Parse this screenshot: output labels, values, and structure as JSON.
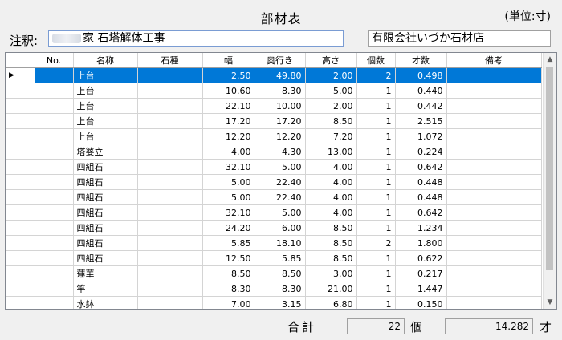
{
  "header": {
    "title": "部材表",
    "unit": "(単位:寸)"
  },
  "note": {
    "label": "注釈:",
    "value": "家 石塔解体工事"
  },
  "shop": {
    "value": "有限会社いづか石材店"
  },
  "columns": [
    "No.",
    "名称",
    "石種",
    "幅",
    "奥行き",
    "高さ",
    "個数",
    "才数",
    "備考"
  ],
  "rows": [
    {
      "no": "",
      "name": "上台",
      "stone": "",
      "width": "2.50",
      "depth": "49.80",
      "height": "2.00",
      "count": "2",
      "sai": "0.498",
      "note": ""
    },
    {
      "no": "",
      "name": "上台",
      "stone": "",
      "width": "10.60",
      "depth": "8.30",
      "height": "5.00",
      "count": "1",
      "sai": "0.440",
      "note": ""
    },
    {
      "no": "",
      "name": "上台",
      "stone": "",
      "width": "22.10",
      "depth": "10.00",
      "height": "2.00",
      "count": "1",
      "sai": "0.442",
      "note": ""
    },
    {
      "no": "",
      "name": "上台",
      "stone": "",
      "width": "17.20",
      "depth": "17.20",
      "height": "8.50",
      "count": "1",
      "sai": "2.515",
      "note": ""
    },
    {
      "no": "",
      "name": "上台",
      "stone": "",
      "width": "12.20",
      "depth": "12.20",
      "height": "7.20",
      "count": "1",
      "sai": "1.072",
      "note": ""
    },
    {
      "no": "",
      "name": "塔婆立",
      "stone": "",
      "width": "4.00",
      "depth": "4.30",
      "height": "13.00",
      "count": "1",
      "sai": "0.224",
      "note": ""
    },
    {
      "no": "",
      "name": "四組石",
      "stone": "",
      "width": "32.10",
      "depth": "5.00",
      "height": "4.00",
      "count": "1",
      "sai": "0.642",
      "note": ""
    },
    {
      "no": "",
      "name": "四組石",
      "stone": "",
      "width": "5.00",
      "depth": "22.40",
      "height": "4.00",
      "count": "1",
      "sai": "0.448",
      "note": ""
    },
    {
      "no": "",
      "name": "四組石",
      "stone": "",
      "width": "5.00",
      "depth": "22.40",
      "height": "4.00",
      "count": "1",
      "sai": "0.448",
      "note": ""
    },
    {
      "no": "",
      "name": "四組石",
      "stone": "",
      "width": "32.10",
      "depth": "5.00",
      "height": "4.00",
      "count": "1",
      "sai": "0.642",
      "note": ""
    },
    {
      "no": "",
      "name": "四組石",
      "stone": "",
      "width": "24.20",
      "depth": "6.00",
      "height": "8.50",
      "count": "1",
      "sai": "1.234",
      "note": ""
    },
    {
      "no": "",
      "name": "四組石",
      "stone": "",
      "width": "5.85",
      "depth": "18.10",
      "height": "8.50",
      "count": "2",
      "sai": "1.800",
      "note": ""
    },
    {
      "no": "",
      "name": "四組石",
      "stone": "",
      "width": "12.50",
      "depth": "5.85",
      "height": "8.50",
      "count": "1",
      "sai": "0.622",
      "note": ""
    },
    {
      "no": "",
      "name": "蓮華",
      "stone": "",
      "width": "8.50",
      "depth": "8.50",
      "height": "3.00",
      "count": "1",
      "sai": "0.217",
      "note": ""
    },
    {
      "no": "",
      "name": "竿",
      "stone": "",
      "width": "8.30",
      "depth": "8.30",
      "height": "21.00",
      "count": "1",
      "sai": "1.447",
      "note": ""
    },
    {
      "no": "",
      "name": "水鉢",
      "stone": "",
      "width": "7.00",
      "depth": "3.15",
      "height": "6.80",
      "count": "1",
      "sai": "0.150",
      "note": ""
    }
  ],
  "selected_row": 0,
  "totals": {
    "label": "合計",
    "count": "22",
    "count_unit": "個",
    "sai": "14.282",
    "sai_unit": "才"
  },
  "icons": {
    "row_pointer": "current-row-arrow-icon",
    "scroll_up": "scroll-up-icon",
    "scroll_down": "scroll-down-icon"
  },
  "colors": {
    "selection": "#0078d7"
  }
}
